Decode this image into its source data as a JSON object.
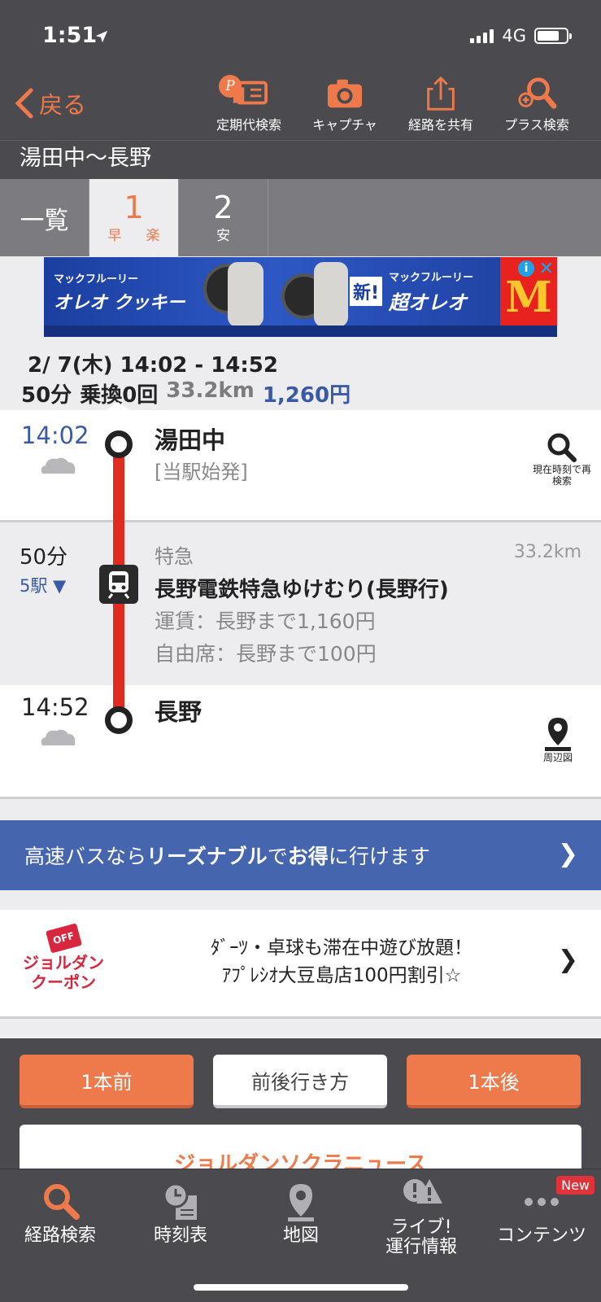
{
  "status": {
    "time": "1:51",
    "network": "4G"
  },
  "nav": {
    "back_label": "戻る",
    "tools": [
      {
        "label": "定期代検索",
        "icon": "pass-card-icon"
      },
      {
        "label": "キャプチャ",
        "icon": "camera-icon"
      },
      {
        "label": "経路を共有",
        "icon": "share-icon"
      },
      {
        "label": "プラス検索",
        "icon": "plus-search-icon"
      }
    ],
    "badge": "P"
  },
  "route_title": "湯田中〜長野",
  "tabs": {
    "list_label": "一覧",
    "items": [
      {
        "num": "1",
        "sub_a": "早",
        "sub_b": "楽",
        "active": true
      },
      {
        "num": "2",
        "sub_a": "安",
        "active": false
      }
    ]
  },
  "ad": {
    "line1": "マックフルーリー",
    "line2": "オレオ クッキー",
    "line3": "マックフルーリー",
    "line4": "超オレオ",
    "new_tag": "新!"
  },
  "summary": {
    "date_time": "2/ 7(木) 14:02 - 14:52",
    "duration": "50分",
    "transfers": "乗換0回",
    "distance": "33.2km",
    "fare": "1,260円"
  },
  "departure": {
    "time": "14:02",
    "station": "湯田中",
    "note": "[当駅始発]",
    "action": "現在時刻で再検索"
  },
  "segment": {
    "duration": "50分",
    "stops": "5駅 ▼",
    "kind": "特急",
    "distance": "33.2km",
    "train": "長野電鉄特急ゆけむり(長野行)",
    "fare": "運賃：長野まで1,160円",
    "seat": "自由席：長野まで100円"
  },
  "arrival": {
    "time": "14:52",
    "station": "長野",
    "action": "周辺図"
  },
  "bus_banner": {
    "prefix": "高速バスなら",
    "bold1": "リーズナブル",
    "mid": "で",
    "bold2": "お得",
    "suffix": "に行けます"
  },
  "coupon": {
    "tag": "OFF",
    "logo_line1": "ジョルダン",
    "logo_line2": "クーポン",
    "msg_line1": "ﾀﾞｰﾂ・卓球も滞在中遊び放題！",
    "msg_line2": "ｱﾌﾟﾚｼｵ大豆島店100円割引☆"
  },
  "actions": {
    "prev": "1本前",
    "around": "前後行き方",
    "next": "1本後"
  },
  "news_label": "ジョルダンソクラニュース",
  "tabbar": [
    {
      "label": "経路検索",
      "icon": "search-icon",
      "active": true
    },
    {
      "label": "時刻表",
      "icon": "timetable-icon"
    },
    {
      "label": "地図",
      "icon": "map-pin-icon"
    },
    {
      "label": "ライブ!\n運行情報",
      "icon": "alert-icon"
    },
    {
      "label": "コンテンツ",
      "icon": "more-icon",
      "badge": "New"
    }
  ],
  "colors": {
    "accent": "#ee7a4c",
    "rail": "#e02b20",
    "link_blue": "#3b5aa6",
    "bus_banner": "#4565ae"
  }
}
